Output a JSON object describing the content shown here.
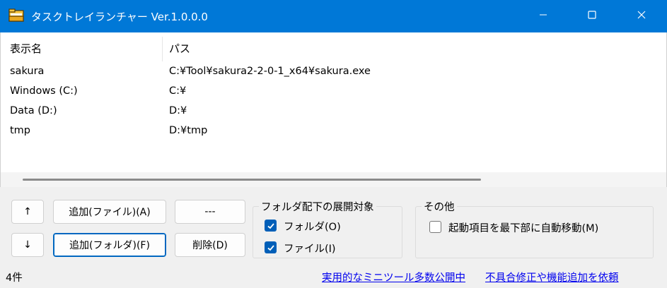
{
  "window": {
    "title": "タスクトレイランチャー Ver.1.0.0.0",
    "icon": "folder-icon",
    "controls": [
      "minimize-icon",
      "maximize-icon",
      "close-icon"
    ]
  },
  "list": {
    "columns": [
      "表示名",
      "パス"
    ],
    "rows": [
      {
        "name": "sakura",
        "path": "C:¥Tool¥sakura2-2-0-1_x64¥sakura.exe"
      },
      {
        "name": "Windows (C:)",
        "path": "C:¥"
      },
      {
        "name": "Data (D:)",
        "path": "D:¥"
      },
      {
        "name": "tmp",
        "path": "D:¥tmp"
      }
    ]
  },
  "buttons": {
    "up": "↑",
    "down": "↓",
    "add_file": "追加(ファイル)(A)",
    "add_folder": "追加(フォルダ)(F)",
    "separator": "---",
    "delete": "削除(D)"
  },
  "expand_group": {
    "title": "フォルダ配下の展開対象",
    "folder_label": "フォルダ(O)",
    "folder_checked": true,
    "file_label": "ファイル(I)",
    "file_checked": true
  },
  "other_group": {
    "title": "その他",
    "auto_move_label": "起動項目を最下部に自動移動(M)",
    "auto_move_checked": false
  },
  "status": {
    "count": "4件",
    "link1": "実用的なミニツール多数公開中",
    "link2": "不具合修正や機能追加を依頼"
  },
  "colors": {
    "titlebar": "#0078d7",
    "checkbox_on": "#005fb8",
    "link": "#0000ee"
  }
}
